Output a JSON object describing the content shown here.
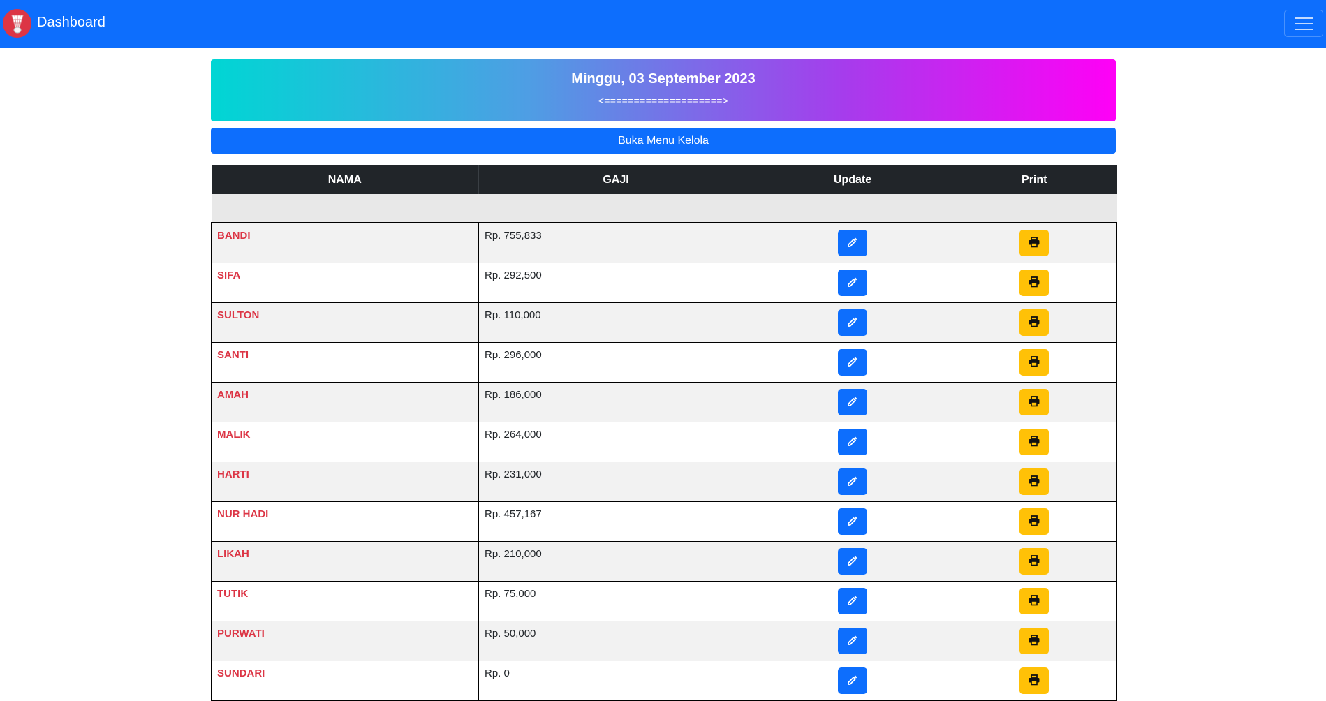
{
  "navbar": {
    "title": "Dashboard",
    "logo_icon": "shuttlecock-icon",
    "menu_icon": "hamburger-icon",
    "color": "#0d6efd"
  },
  "banner": {
    "date": "Minggu, 03 September 2023",
    "arrows": "<====================>"
  },
  "menu_button": {
    "label": "Buka Menu Kelola"
  },
  "table": {
    "headers": [
      "NAMA",
      "GAJI",
      "Update",
      "Print"
    ],
    "rows": [
      {
        "nama": "BANDI",
        "gaji": "Rp. 755,833"
      },
      {
        "nama": "SIFA",
        "gaji": "Rp. 292,500"
      },
      {
        "nama": "SULTON",
        "gaji": "Rp. 110,000"
      },
      {
        "nama": "SANTI",
        "gaji": "Rp. 296,000"
      },
      {
        "nama": "AMAH",
        "gaji": "Rp. 186,000"
      },
      {
        "nama": "MALIK",
        "gaji": "Rp. 264,000"
      },
      {
        "nama": "HARTI",
        "gaji": "Rp. 231,000"
      },
      {
        "nama": "NUR HADI",
        "gaji": "Rp. 457,167"
      },
      {
        "nama": "LIKAH",
        "gaji": "Rp. 210,000"
      },
      {
        "nama": "TUTIK",
        "gaji": "Rp. 75,000"
      },
      {
        "nama": "PURWATI",
        "gaji": "Rp. 50,000"
      },
      {
        "nama": "SUNDARI",
        "gaji": "Rp. 0"
      }
    ],
    "update_icon": "edit-icon",
    "print_icon": "printer-icon",
    "name_color": "#dc3545",
    "update_color": "#0d6efd",
    "print_color": "#ffc107"
  }
}
